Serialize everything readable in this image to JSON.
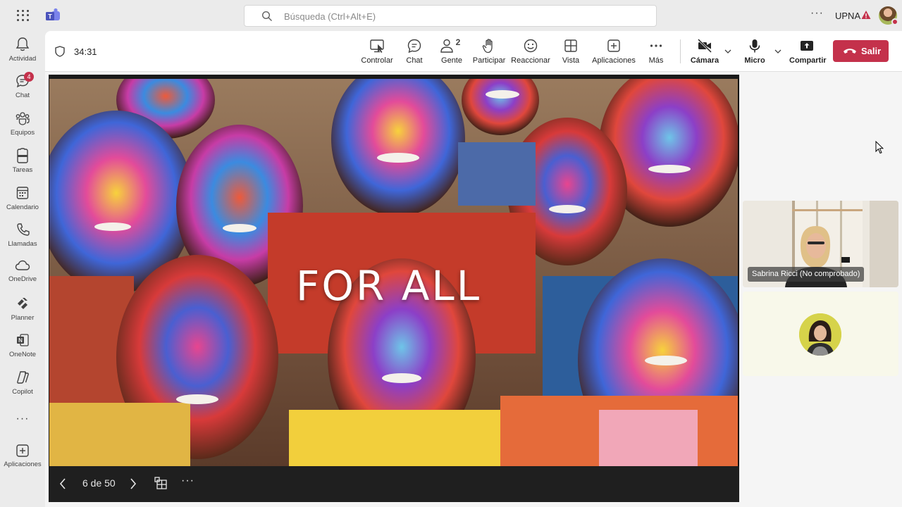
{
  "topbar": {
    "search_placeholder": "Búsqueda (Ctrl+Alt+E)",
    "more_label": "···",
    "org_name": "UPNA",
    "icons": [
      "app-launcher-icon",
      "teams-logo-icon",
      "search-icon",
      "warning-icon",
      "avatar"
    ]
  },
  "rail": {
    "items": [
      {
        "label": "Actividad",
        "icon": "bell-icon"
      },
      {
        "label": "Chat",
        "icon": "chat-icon",
        "badge": "4"
      },
      {
        "label": "Equipos",
        "icon": "teams-icon"
      },
      {
        "label": "Tareas",
        "icon": "tasks-icon"
      },
      {
        "label": "Calendario",
        "icon": "calendar-icon"
      },
      {
        "label": "Llamadas",
        "icon": "phone-icon"
      },
      {
        "label": "OneDrive",
        "icon": "cloud-icon"
      },
      {
        "label": "Planner",
        "icon": "planner-icon"
      },
      {
        "label": "OneNote",
        "icon": "onenote-icon"
      },
      {
        "label": "Copilot",
        "icon": "copilot-icon"
      },
      {
        "label": "Aplicaciones",
        "icon": "add-apps-icon"
      }
    ],
    "more_label": "···"
  },
  "meeting": {
    "timer": "34:31",
    "controls": [
      {
        "label": "Controlar",
        "icon": "control-icon"
      },
      {
        "label": "Chat",
        "icon": "chat-icon"
      },
      {
        "label": "Gente",
        "icon": "people-icon",
        "count": "2"
      },
      {
        "label": "Participar",
        "icon": "raise-hand-icon"
      },
      {
        "label": "Reaccionar",
        "icon": "emoji-icon"
      },
      {
        "label": "Vista",
        "icon": "view-icon"
      },
      {
        "label": "Aplicaciones",
        "icon": "add-apps-icon"
      },
      {
        "label": "Más",
        "icon": "more-icon"
      },
      {
        "label": "Cámara",
        "icon": "camera-off-icon"
      },
      {
        "label": "Micro",
        "icon": "mic-icon"
      },
      {
        "label": "Compartir",
        "icon": "share-icon"
      }
    ],
    "leave_label": "Salir"
  },
  "slide": {
    "text": "FOR ALL",
    "counter": "6 de 50",
    "more_label": "···"
  },
  "participants": [
    {
      "name": "Sabrina Ricci (No comprobado)",
      "video": true
    },
    {
      "name": "",
      "video": false
    }
  ],
  "colors": {
    "accent_red": "#c4314b",
    "teams_purple": "#5b5fc7",
    "rail_bg": "#ebebeb",
    "stage_bg": "#1f1f1f"
  }
}
